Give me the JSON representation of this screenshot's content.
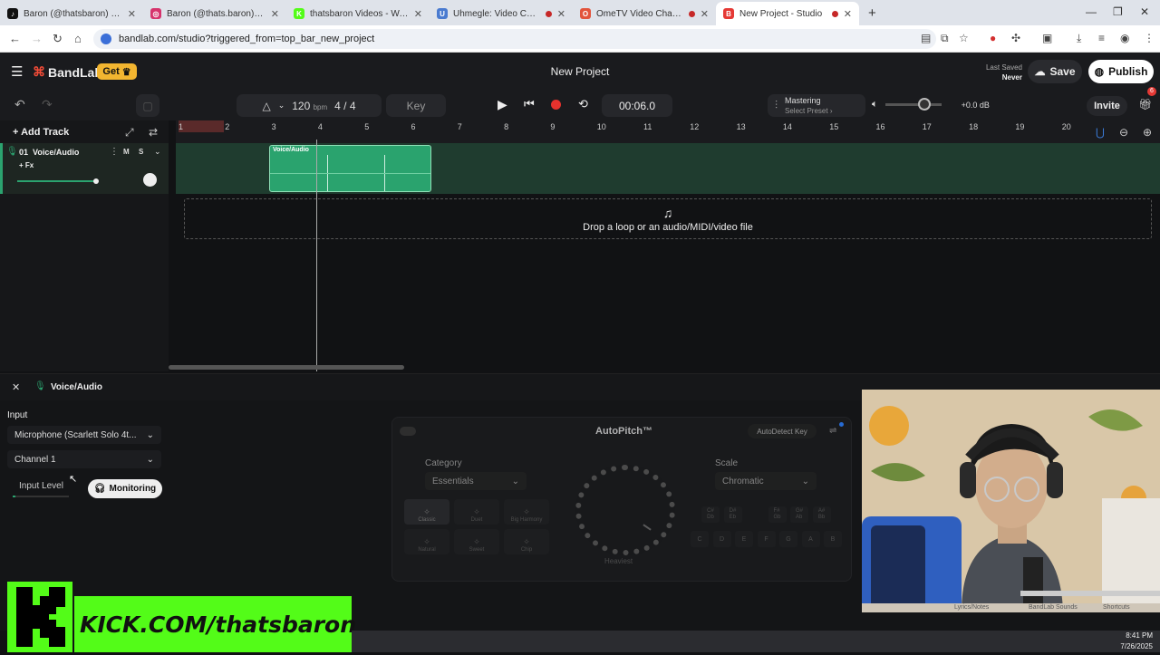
{
  "browser": {
    "tabs": [
      {
        "title": "Baron (@thatsbaron) | TikTok",
        "fav": "#111",
        "glyph": "♪"
      },
      {
        "title": "Baron (@thats.baron) • Instagram",
        "fav": "#d6336c",
        "glyph": "◎"
      },
      {
        "title": "thatsbaron Videos - Watch On Kick",
        "fav": "#53fc18",
        "glyph": "K"
      },
      {
        "title": "Uhmegle: Video Chat | Omegle",
        "fav": "#4a7bd0",
        "glyph": "U"
      },
      {
        "title": "OmeTV Video Chat — Omegle",
        "fav": "#e2543c",
        "glyph": "O"
      },
      {
        "title": "New Project - Studio",
        "fav": "#e53935",
        "glyph": "B"
      }
    ],
    "new_tab": "+",
    "url": "bandlab.com/studio?triggered_from=top_bar_new_project"
  },
  "app": {
    "brand": "BandLab",
    "get_label": "Get",
    "project_title": "New Project",
    "last_saved_label": "Last Saved",
    "last_saved_value": "Never",
    "save_label": "Save",
    "publish_label": "Publish",
    "notif_count": "6"
  },
  "toolbar": {
    "bpm_value": "120",
    "bpm_unit": "bpm",
    "time_sig": "4 / 4",
    "key_label": "Key",
    "time": "00:06.0",
    "mastering_label": "Mastering",
    "mastering_preset": "Select Preset",
    "volume_db": "+0.0 dB",
    "invite_label": "Invite"
  },
  "tracks": {
    "add_track_label": "Add Track",
    "track": {
      "name": "01  Voice/Audio",
      "mute": "M",
      "solo": "S",
      "fx": "+ Fx"
    },
    "ruler": [
      "1",
      "2",
      "3",
      "4",
      "5",
      "6",
      "7",
      "8",
      "9",
      "10",
      "11",
      "12",
      "13",
      "14",
      "15",
      "16",
      "17",
      "18",
      "19",
      "20"
    ],
    "clip_label": "Voice/Audio",
    "drop_text": "Drop a loop or an audio/MIDI/video file"
  },
  "panel": {
    "title": "Voice/Audio",
    "input_label": "Input",
    "input_device": "Microphone (Scarlett Solo 4t...",
    "channel": "Channel 1",
    "input_level_label": "Input Level",
    "monitoring_label": "Monitoring",
    "autopitch": {
      "title": "AutoPitch™",
      "autodetect": "AutoDetect Key",
      "category_label": "Category",
      "category_value": "Essentials",
      "scale_label": "Scale",
      "scale_value": "Chromatic",
      "modes": [
        "Classic",
        "Duet",
        "Big Harmony",
        "Natural",
        "Sweet",
        "Chip"
      ],
      "knob_label": "Heaviest",
      "sharps": [
        "C#\nDb",
        "D#\nEb",
        "F#\nGb",
        "G#\nAb",
        "A#\nBb"
      ],
      "naturals": [
        "C",
        "D",
        "E",
        "F",
        "G",
        "A",
        "B"
      ]
    }
  },
  "overlay": {
    "kick_text": "KICK.COM/thatsbaron",
    "cam_labels": [
      "Lyrics/Notes",
      "BandLab Sounds",
      "Shortcuts"
    ],
    "clock_time": "8:41 PM",
    "clock_date": "7/26/2025"
  }
}
